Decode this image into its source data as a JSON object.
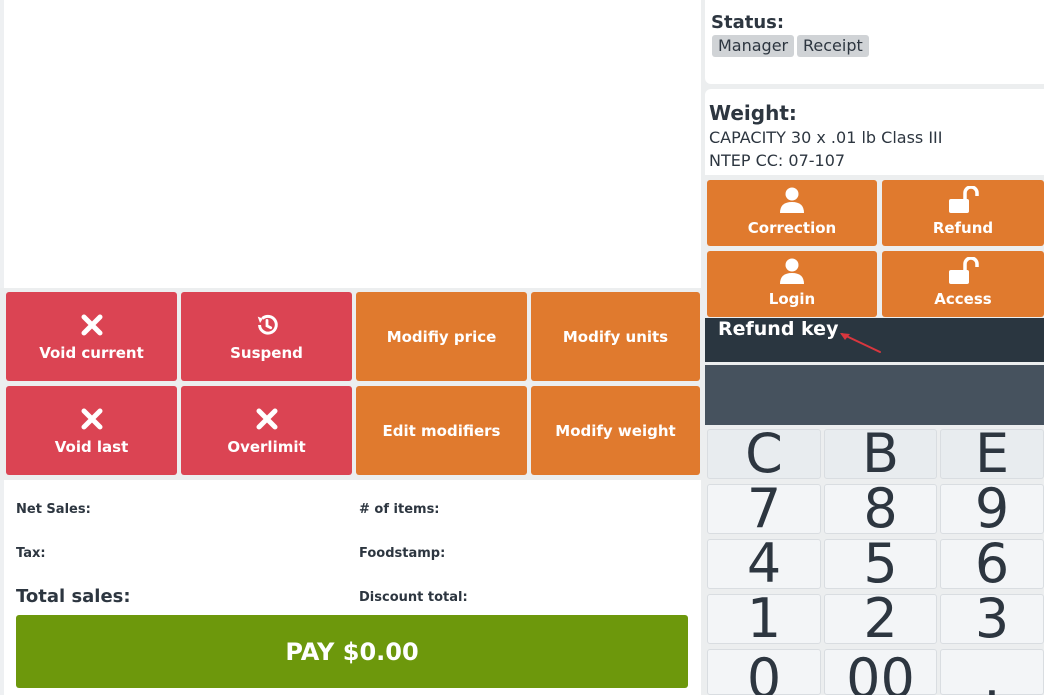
{
  "function_buttons": [
    {
      "id": "void-current",
      "label": "Void current",
      "icon": "x-icon"
    },
    {
      "id": "suspend",
      "label": "Suspend",
      "icon": "history-icon"
    },
    {
      "id": "modify-price",
      "label": "Modifiy price"
    },
    {
      "id": "modify-units",
      "label": "Modify units"
    },
    {
      "id": "void-last",
      "label": "Void last",
      "icon": "x-icon"
    },
    {
      "id": "overlimit",
      "label": "Overlimit",
      "icon": "x-icon"
    },
    {
      "id": "edit-modifiers",
      "label": "Edit modifiers"
    },
    {
      "id": "modify-weight",
      "label": "Modify weight"
    }
  ],
  "totals": {
    "net_sales_label": "Net Sales:",
    "tax_label": "Tax:",
    "total_sales_label": "Total sales:",
    "items_label": "# of items:",
    "foodstamp_label": "Foodstamp:",
    "discount_label": "Discount total:"
  },
  "pay_button": {
    "label": "PAY $0.00"
  },
  "status": {
    "title": "Status:",
    "tags": [
      "Manager",
      "Receipt"
    ]
  },
  "weight": {
    "title": "Weight:",
    "capacity": "CAPACITY 30 x .01 lb Class III",
    "ntep": "NTEP CC: 07-107"
  },
  "keyswitch": [
    {
      "label": "Correction",
      "icon": "user-icon"
    },
    {
      "label": "Refund",
      "icon": "unlock-icon"
    },
    {
      "label": "Login",
      "icon": "user-icon"
    },
    {
      "label": "Access",
      "icon": "unlock-icon"
    }
  ],
  "message": {
    "text": "Refund key"
  },
  "keypad": {
    "letters": [
      "C",
      "B",
      "E"
    ],
    "row1": [
      "7",
      "8",
      "9"
    ],
    "row2": [
      "4",
      "5",
      "6"
    ],
    "row3": [
      "1",
      "2",
      "3"
    ],
    "row4": [
      "0",
      "00",
      "."
    ]
  },
  "colors": {
    "red": "#db4453",
    "orange": "#e07a2e",
    "green": "#6d980c",
    "dark": "#2a3640"
  }
}
